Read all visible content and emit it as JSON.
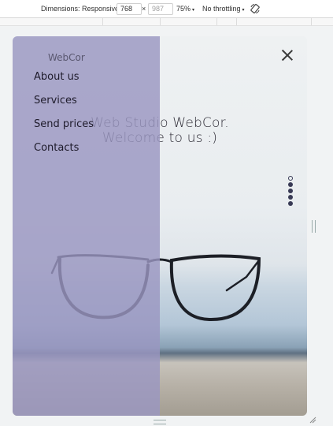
{
  "devtools": {
    "dimensions_label": "Dimensions: Responsive",
    "width": "768",
    "height": "987",
    "times": "×",
    "zoom": "75%",
    "throttling": "No throttling",
    "caret": "▾"
  },
  "site": {
    "logo": "WebCor",
    "menu_items": [
      "About us",
      "Services",
      "Send prices",
      "Contacts"
    ],
    "hero_line1": "Web Studio WebCor.",
    "hero_line2": "Welcome to us :)",
    "slider_dots": 5,
    "active_dot": 0
  },
  "colors": {
    "menu_overlay": "#9a96c1",
    "accent_dark": "#383a55"
  }
}
